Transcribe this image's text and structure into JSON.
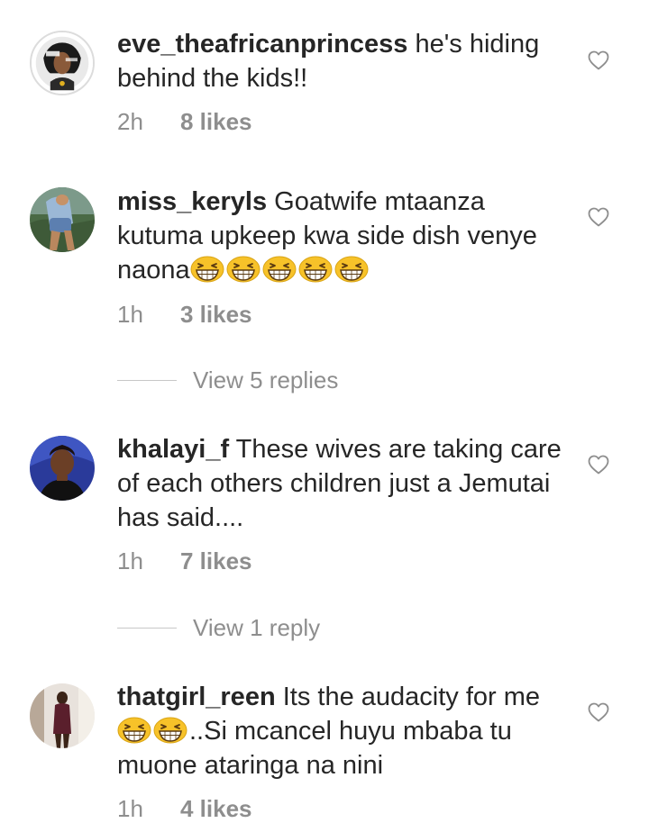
{
  "comments": [
    {
      "username": "eve_theafricanprincess",
      "text": " he's hiding behind the kids!!",
      "emoji_count": 0,
      "trailing_text": "",
      "time": "2h",
      "likes": "8 likes"
    },
    {
      "username": "miss_keryls",
      "text": " Goatwife mtaanza kutuma upkeep kwa side dish venye naona",
      "emoji_count": 5,
      "trailing_text": "",
      "time": "1h",
      "likes": "3 likes"
    },
    {
      "username": "khalayi_f",
      "text": " These wives are taking care of each others children just a Jemutai has said....",
      "emoji_count": 0,
      "trailing_text": "",
      "time": "1h",
      "likes": "7 likes"
    },
    {
      "username": "thatgirl_reen",
      "text": " Its the audacity for me ",
      "emoji_count": 2,
      "trailing_text": "..Si mcancel huyu mbaba tu muone ataringa na nini",
      "time": "1h",
      "likes": "4 likes"
    }
  ],
  "view_replies": [
    {
      "label": "View 5 replies"
    },
    {
      "label": "View 1 reply"
    }
  ],
  "icons": {
    "like": "heart-outline-icon",
    "emoji": "grinning-squinting-face-emoji"
  },
  "colors": {
    "text": "#262626",
    "secondary": "#8e8e8e",
    "divider": "#c7c7c7",
    "emoji": "#f7c229"
  }
}
